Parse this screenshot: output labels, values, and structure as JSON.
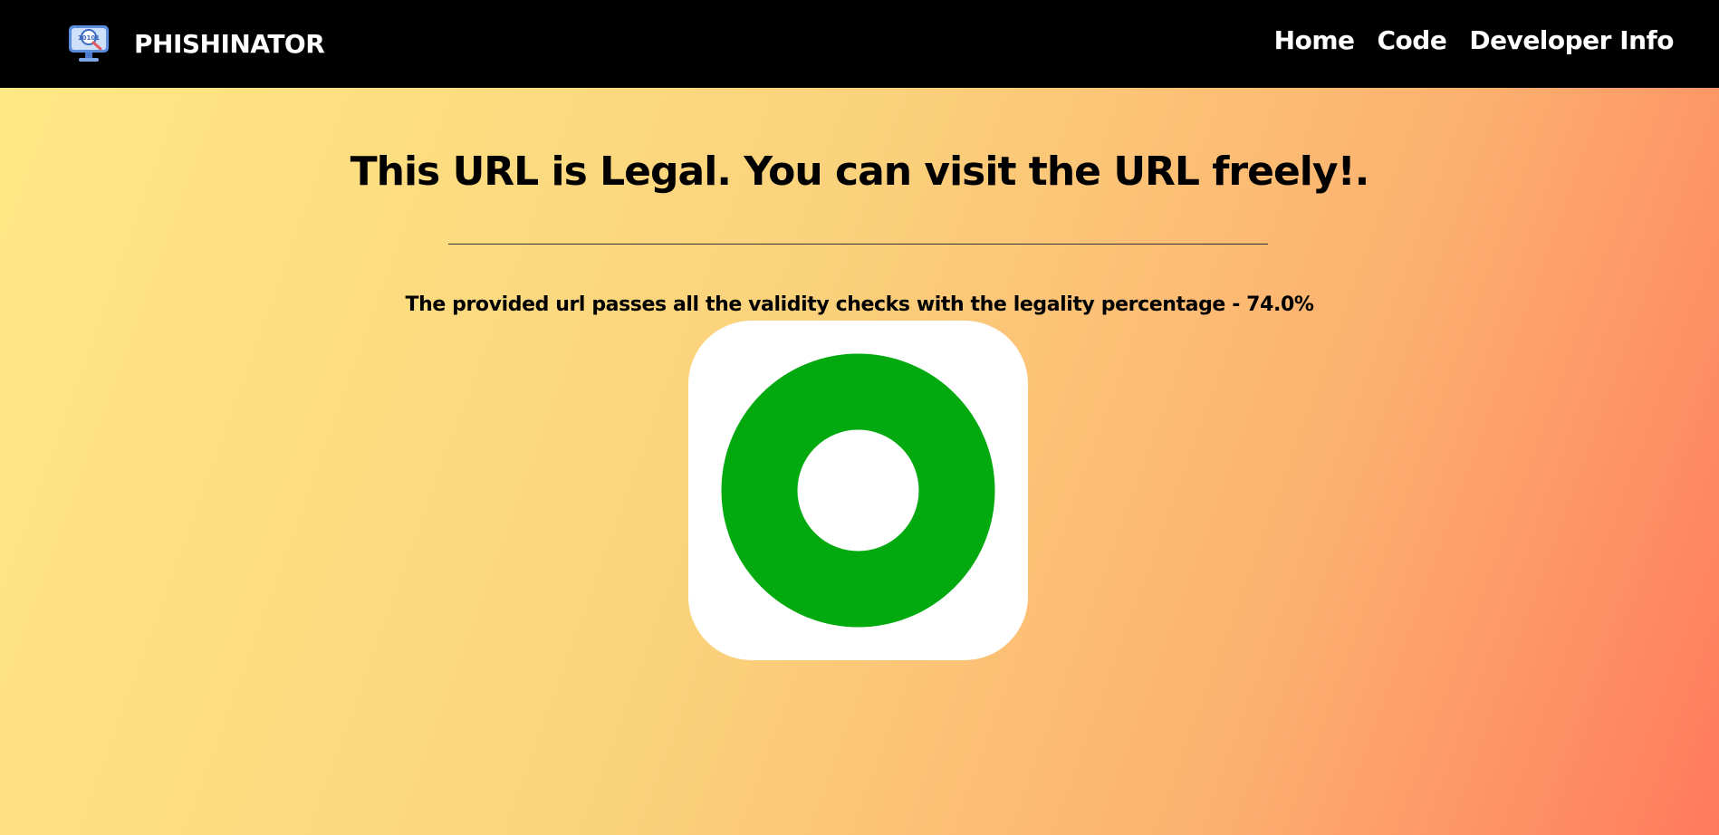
{
  "nav": {
    "brand": "PHISHINATOR",
    "logo_icon": "monitor-magnifier-icon",
    "links": [
      {
        "label": "Home"
      },
      {
        "label": "Code"
      },
      {
        "label": "Developer Info"
      }
    ]
  },
  "result": {
    "headline": "This URL is Legal. You can visit the URL freely!.",
    "message": "The provided url passes all the validity checks with the legality percentage - 74.0%",
    "status_icon": "green-ring-icon"
  },
  "colors": {
    "navbar": "#000000",
    "status_green": "#03aa0f",
    "gradient_start": "#ffe985",
    "gradient_end": "#ff7a5c"
  }
}
